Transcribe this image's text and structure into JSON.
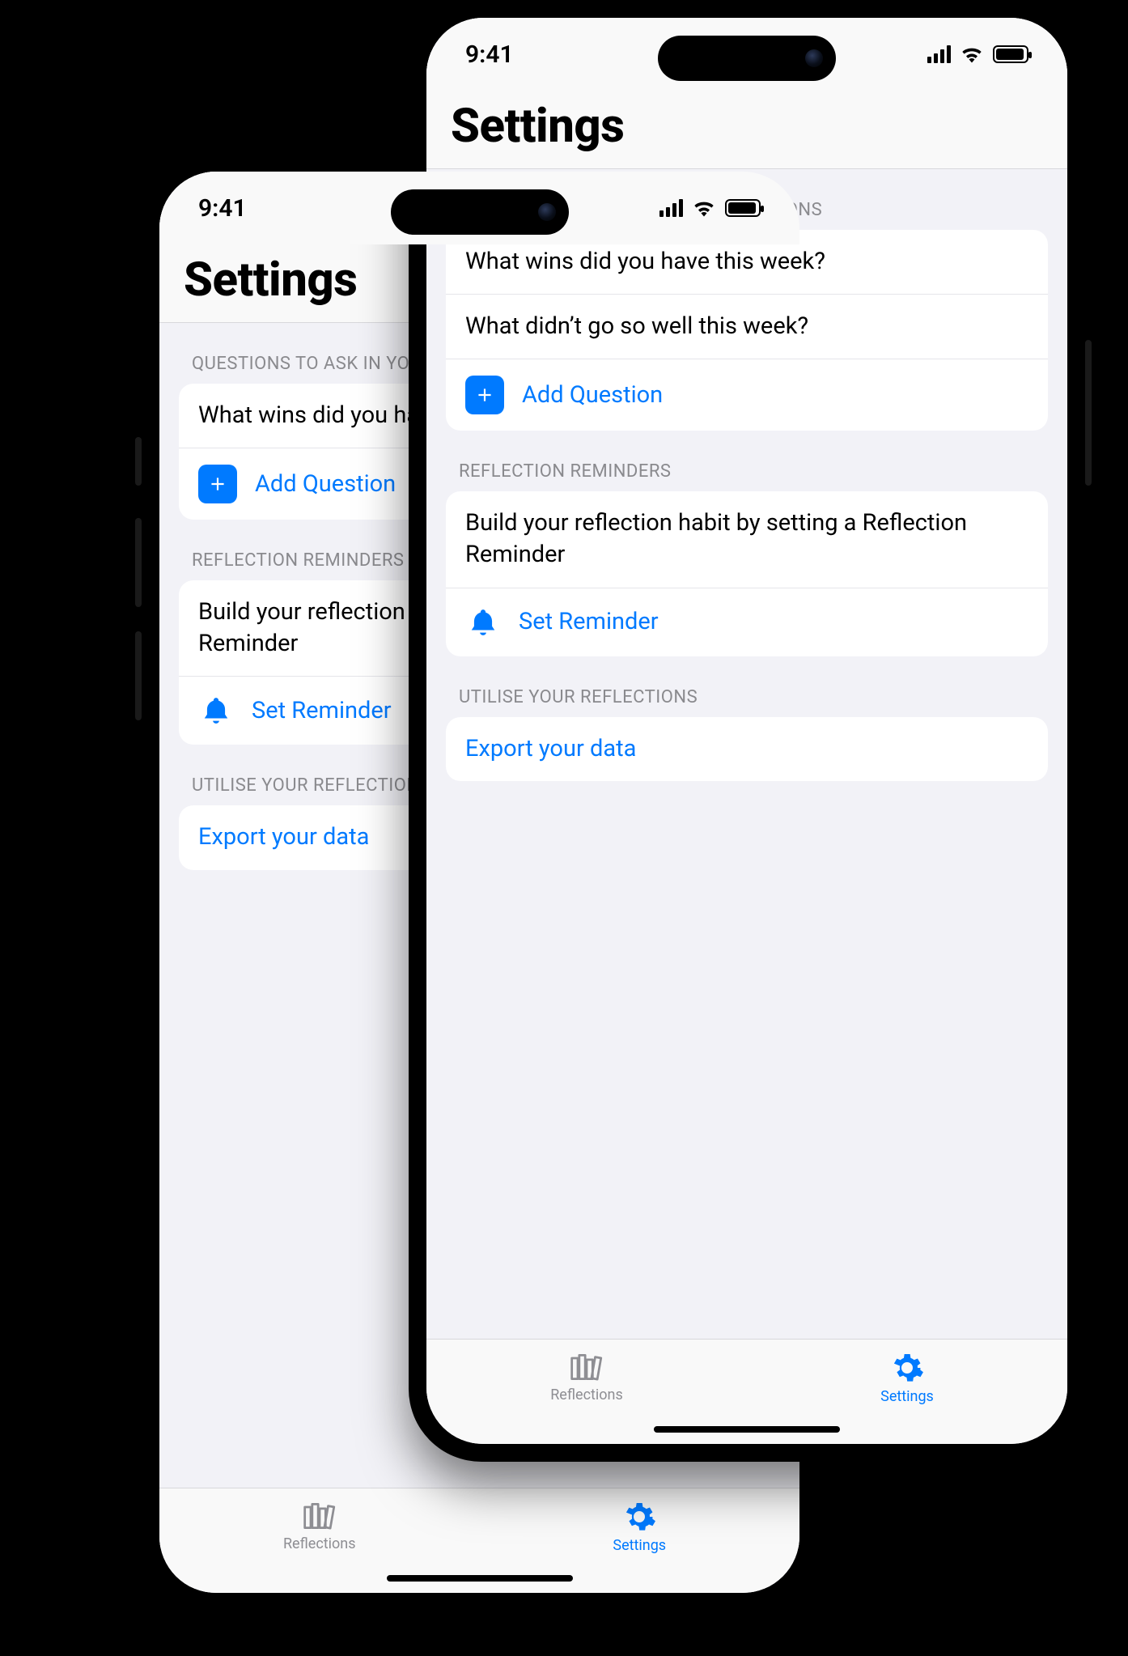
{
  "status": {
    "time": "9:41"
  },
  "page_title": "Settings",
  "sections": {
    "questions_header": "QUESTIONS TO ASK IN YOUR REFLECTIONS",
    "reminders_header": "REFLECTION REMINDERS",
    "utilise_header": "UTILISE YOUR REFLECTIONS"
  },
  "questions": [
    "What wins did you have this week?",
    "What didn’t go so well this week?"
  ],
  "add_question_label": "Add Question",
  "reminder_prompt": "Build your reflection habit by setting a Reflection Reminder",
  "set_reminder_label": "Set Reminder",
  "export_label": "Export your data",
  "tabs": {
    "reflections": "Reflections",
    "settings": "Settings"
  },
  "colors": {
    "accent": "#007aff",
    "background": "#f2f2f7",
    "card": "#ffffff",
    "muted": "#8e8e93"
  }
}
